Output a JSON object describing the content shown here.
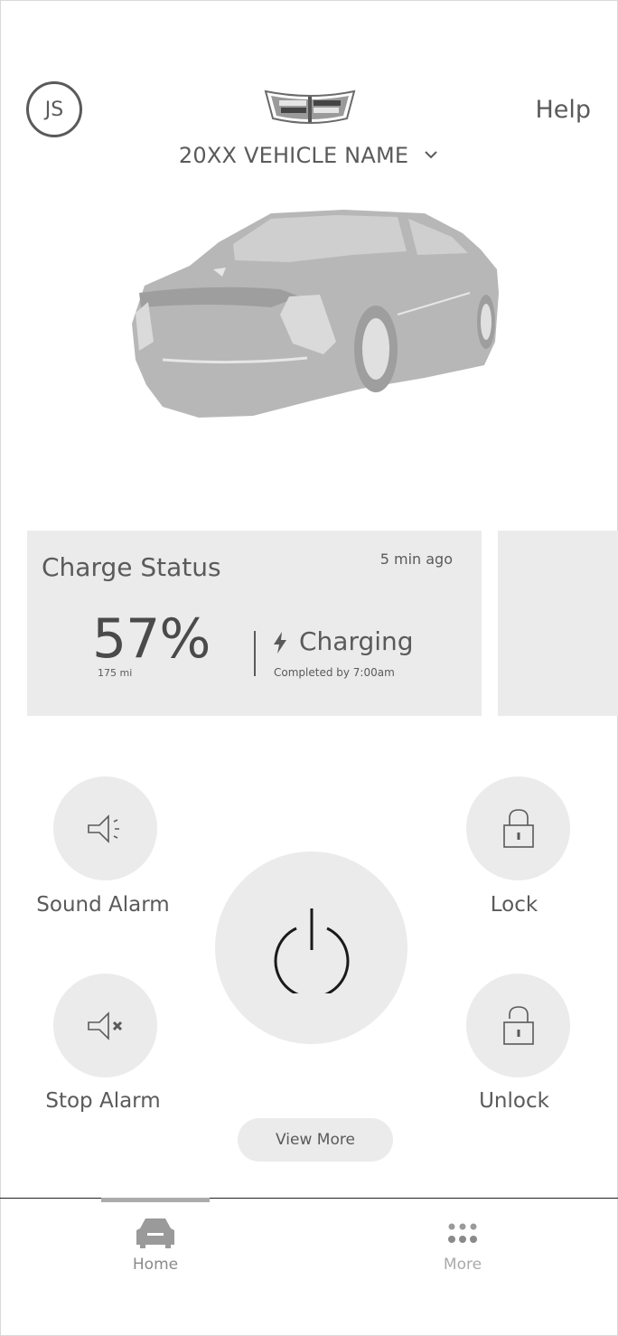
{
  "header": {
    "avatar_initials": "JS",
    "help_label": "Help",
    "vehicle_name": "20XX VEHICLE NAME",
    "logo_icon": "crest-logo-icon",
    "vehicle_icon": "vehicle-image"
  },
  "charge_card": {
    "title": "Charge Status",
    "updated": "5 min ago",
    "percent": "57%",
    "range": "175 mi",
    "status": "Charging",
    "completion": "Completed by 7:00am",
    "status_icon": "lightning-bolt-icon"
  },
  "actions": {
    "sound_alarm": {
      "label": "Sound Alarm",
      "icon": "horn-sound-icon"
    },
    "stop_alarm": {
      "label": "Stop Alarm",
      "icon": "horn-mute-icon"
    },
    "lock": {
      "label": "Lock",
      "icon": "padlock-closed-icon"
    },
    "unlock": {
      "label": "Unlock",
      "icon": "padlock-open-icon"
    },
    "power": {
      "icon": "power-icon"
    },
    "view_more_label": "View More"
  },
  "tabbar": {
    "tabs": [
      {
        "label": "Home",
        "icon": "car-icon",
        "active": true
      },
      {
        "label": "More",
        "icon": "dots-grid-icon",
        "active": false
      }
    ]
  },
  "colors": {
    "card_bg": "#ebebeb",
    "text": "#5a5a5a",
    "vehicle_fill": "#b7b7b7"
  }
}
